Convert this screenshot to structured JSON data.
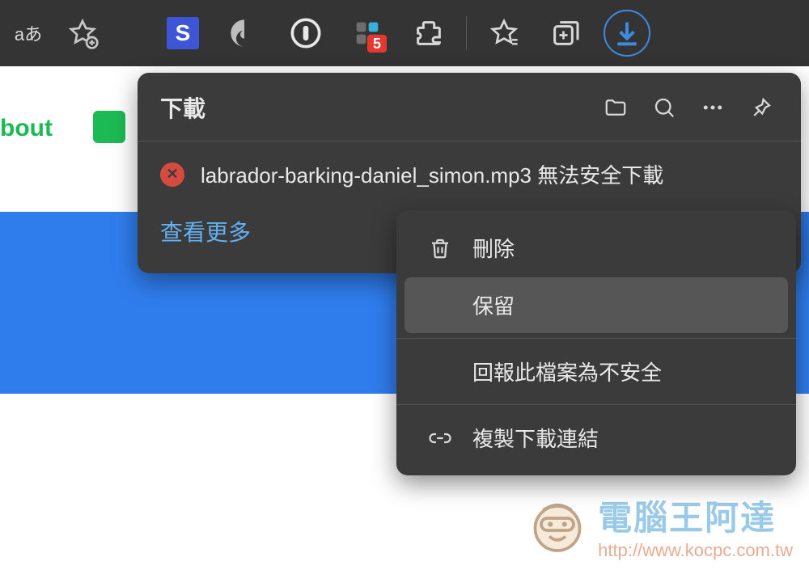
{
  "toolbar": {
    "translate_label": "aあ",
    "s_label": "S",
    "badge_count": "5"
  },
  "page": {
    "about_link": "bout"
  },
  "downloads": {
    "title": "下載",
    "item_text": "labrador-barking-daniel_simon.mp3 無法安全下載",
    "see_more": "查看更多"
  },
  "context_menu": {
    "delete": "刪除",
    "keep": "保留",
    "report_unsafe": "回報此檔案為不安全",
    "copy_link": "複製下載連結"
  },
  "watermark": {
    "title": "電腦王阿達",
    "url": "http://www.kocpc.com.tw"
  }
}
